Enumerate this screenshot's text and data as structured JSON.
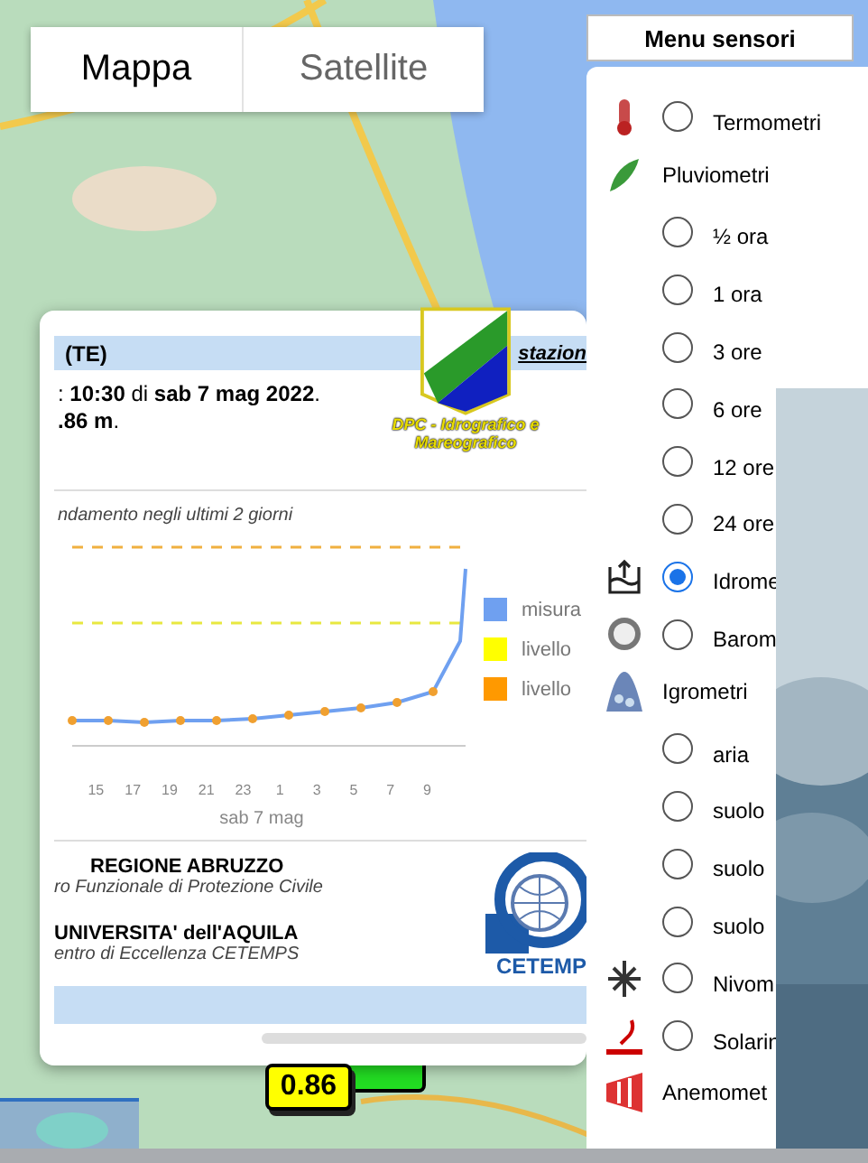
{
  "map_type_tabs": [
    {
      "label": "Mappa",
      "selected": true
    },
    {
      "label": "Satellite",
      "selected": false
    }
  ],
  "station_popup": {
    "header": "(TE)",
    "header_link": "stazion",
    "logo_caption": "DPC - Idrografico e Mareografico",
    "reading_time": ": **10:30** di **sab 7 mag 2022**.",
    "reading_value": "**.86 m**.",
    "chart_caption": "ndamento negli ultimi 2 giorni",
    "chart": {
      "xticks": [
        "15",
        "17",
        "19",
        "21",
        "23",
        "1",
        "3",
        "5",
        "7",
        "9"
      ],
      "xlabel": "sab 7 mag",
      "legend": [
        {
          "label": "misura",
          "color": "#6fa0f0"
        },
        {
          "label": "livello",
          "color": "#ffff00"
        },
        {
          "label": "livello",
          "color": "#ff9900"
        }
      ]
    },
    "credits": [
      {
        "title": "REGIONE ABRUZZO",
        "subtitle": "ro Funzionale di Protezione Civile"
      },
      {
        "title": "UNIVERSITA' dell'AQUILA",
        "subtitle": "entro di Eccellenza CETEMPS"
      }
    ],
    "cetemps_logo": "CETEMP"
  },
  "map_marker": {
    "value": "0.86"
  },
  "sensor_menu": {
    "title": "Menu sensori",
    "items": [
      {
        "kind": "radio",
        "label": "Termometri",
        "selected": false
      },
      {
        "kind": "group",
        "label": "Pluviometri"
      },
      {
        "kind": "radio",
        "label": "½ ora",
        "selected": false
      },
      {
        "kind": "radio",
        "label": "1 ora",
        "selected": false
      },
      {
        "kind": "radio",
        "label": "3 ore",
        "selected": false
      },
      {
        "kind": "radio",
        "label": "6 ore",
        "selected": false
      },
      {
        "kind": "radio",
        "label": "12 ore",
        "selected": false
      },
      {
        "kind": "radio",
        "label": "24 ore",
        "selected": false
      },
      {
        "kind": "radio",
        "label": "Idrome",
        "selected": true
      },
      {
        "kind": "radio",
        "label": "Barom",
        "selected": false
      },
      {
        "kind": "group",
        "label": "Igrometri"
      },
      {
        "kind": "radio",
        "label": "aria",
        "selected": false
      },
      {
        "kind": "radio",
        "label": "suolo",
        "selected": false
      },
      {
        "kind": "radio",
        "label": "suolo",
        "selected": false
      },
      {
        "kind": "radio",
        "label": "suolo",
        "selected": false
      },
      {
        "kind": "radio",
        "label": "Nivom",
        "selected": false
      },
      {
        "kind": "radio",
        "label": "Solarin",
        "selected": false
      },
      {
        "kind": "group",
        "label": "Anemomet"
      }
    ]
  }
}
